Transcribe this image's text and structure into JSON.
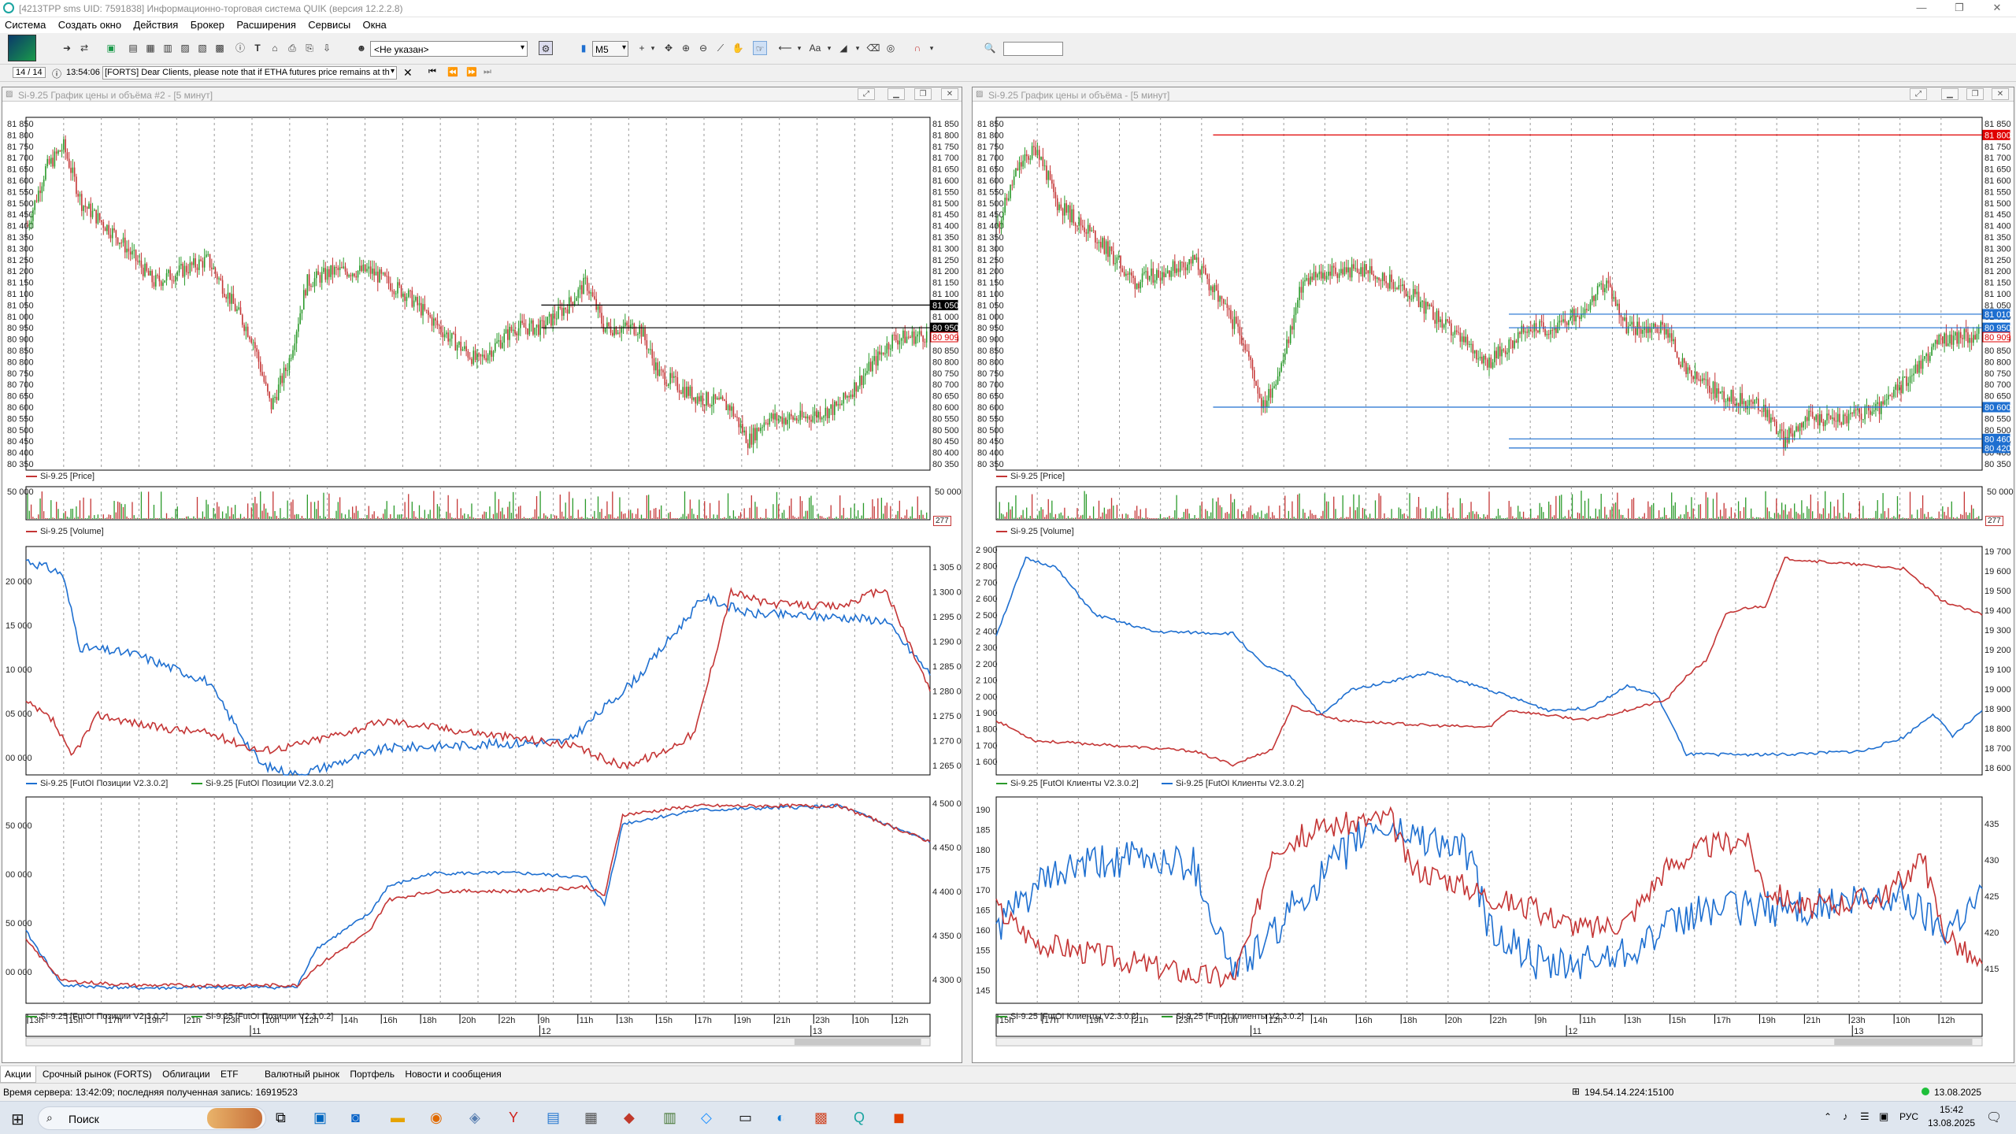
{
  "window": {
    "title": "[4213TPP sms UID: 7591838] Информационно-торговая система QUIK (версия 12.2.2.8)"
  },
  "menu": [
    "Система",
    "Создать окно",
    "Действия",
    "Брокер",
    "Расширения",
    "Сервисы",
    "Окна"
  ],
  "toolbar": {
    "account_select": "<Не указан>",
    "interval_select": "M5",
    "font_label": "Aa",
    "search_value": ""
  },
  "news": {
    "counter": "14 / 14",
    "time": "13:54:06",
    "text": "[FORTS] Dear Clients, please note that if ETHA futures price remains at th"
  },
  "left_window": {
    "title": "Si-9.25 График цены и объёма #2 - [5 минут]",
    "price_legend": "Si-9.25 [Price]",
    "volume_legend": "Si-9.25 [Volume]",
    "volume_tick_left": "50 000",
    "volume_tick_right": "50 000",
    "volume_badge": "277",
    "fut_legend_1": "Si-9.25 [FutOI Позиции V2.3.0.2]",
    "fut_legend_2": "Si-9.25 [FutOI Позиции V2.3.0.2]",
    "fut2_legend_1": "Si-9.25 [FutOI Позиции V2.3.0.2]",
    "fut2_legend_2": "Si-9.25 [FutOI Позиции V2.3.0.2]",
    "price_ticks": [
      "81 850",
      "81 800",
      "81 750",
      "81 700",
      "81 650",
      "81 600",
      "81 550",
      "81 500",
      "81 450",
      "81 400",
      "81 350",
      "81 300",
      "81 250",
      "81 200",
      "81 150",
      "81 100",
      "81 050",
      "81 000",
      "80 950",
      "80 900",
      "80 850",
      "80 800",
      "80 750",
      "80 700",
      "80 650",
      "80 600",
      "80 550",
      "80 500",
      "80 450",
      "80 400",
      "80 350"
    ],
    "price_badges": [
      {
        "text": "81 050",
        "price": 81050,
        "bg": "#000000",
        "fg": "#ffffff"
      },
      {
        "text": "80 950",
        "price": 80950,
        "bg": "#000000",
        "fg": "#ffffff"
      },
      {
        "text": "80 909",
        "price": 80909,
        "bg": "#ffffff",
        "fg": "#e00000"
      }
    ],
    "fut_left_ticks": [
      "20 000",
      "15 000",
      "10 000",
      "05 000",
      "00 000"
    ],
    "fut_right_ticks": [
      "1 305 0",
      "1 300 0",
      "1 295 0",
      "1 290 0",
      "1 285 0",
      "1 280 0",
      "1 275 0",
      "1 270 0",
      "1 265 0"
    ],
    "fut2_left_ticks": [
      "50 000",
      "00 000",
      "50 000",
      "00 000"
    ],
    "fut2_right_ticks": [
      "4 500 0",
      "4 450 0",
      "4 400 0",
      "4 350 0",
      "4 300 0"
    ],
    "time_labels": [
      "13h",
      "15h",
      "17h",
      "19h",
      "21h",
      "23h",
      "10h",
      "12h",
      "14h",
      "16h",
      "18h",
      "20h",
      "22h",
      "9h",
      "11h",
      "13h",
      "15h",
      "17h",
      "19h",
      "21h",
      "23h",
      "10h",
      "12h"
    ],
    "date_labels": [
      "11",
      "12",
      "13"
    ]
  },
  "right_window": {
    "title": "Si-9.25 График цены и объёма - [5 минут]",
    "price_legend": "Si-9.25 [Price]",
    "volume_legend": "Si-9.25 [Volume]",
    "volume_tick_right": "50 000",
    "volume_badge": "277",
    "fut_legend_1": "Si-9.25 [FutOI Клиенты V2.3.0.2]",
    "fut_legend_2": "Si-9.25 [FutOI Клиенты V2.3.0.2]",
    "fut2_legend_1": "Si-9.25 [FutOI Клиенты V2.3.0.2]",
    "fut2_legend_2": "Si-9.25 [FutOI Клиенты V2.3.0.2]",
    "price_badges": [
      {
        "text": "81 800",
        "price": 81800,
        "bg": "#e00000",
        "fg": "#ffffff"
      },
      {
        "text": "81 010",
        "price": 81010,
        "bg": "#1e6fd0",
        "fg": "#ffffff"
      },
      {
        "text": "80 950",
        "price": 80950,
        "bg": "#1e6fd0",
        "fg": "#ffffff"
      },
      {
        "text": "80 909",
        "price": 80909,
        "bg": "#ffffff",
        "fg": "#e00000"
      },
      {
        "text": "80 600",
        "price": 80600,
        "bg": "#1e6fd0",
        "fg": "#ffffff"
      },
      {
        "text": "80 460",
        "price": 80460,
        "bg": "#1e6fd0",
        "fg": "#ffffff"
      },
      {
        "text": "80 420",
        "price": 80420,
        "bg": "#1e6fd0",
        "fg": "#ffffff"
      }
    ],
    "fut_left_ticks": [
      "2 900",
      "2 800",
      "2 700",
      "2 600",
      "2 500",
      "2 400",
      "2 300",
      "2 200",
      "2 100",
      "2 000",
      "1 900",
      "1 800",
      "1 700",
      "1 600"
    ],
    "fut_right_ticks": [
      "19 700",
      "19 600",
      "19 500",
      "19 400",
      "19 300",
      "19 200",
      "19 100",
      "19 000",
      "18 900",
      "18 800",
      "18 700",
      "18 600"
    ],
    "fut2_left_ticks": [
      "190",
      "185",
      "180",
      "175",
      "170",
      "165",
      "160",
      "155",
      "150",
      "145"
    ],
    "fut2_right_ticks": [
      "435",
      "430",
      "425",
      "420",
      "415"
    ],
    "time_labels": [
      "15h",
      "17h",
      "19h",
      "21h",
      "23h",
      "10h",
      "12h",
      "14h",
      "16h",
      "18h",
      "20h",
      "22h",
      "9h",
      "11h",
      "13h",
      "15h",
      "17h",
      "19h",
      "21h",
      "23h",
      "10h",
      "12h"
    ],
    "date_labels": [
      "11",
      "12",
      "13"
    ]
  },
  "tabs": [
    "Акции",
    "Срочный рынок (FORTS)",
    "Облигации",
    "ETF",
    "Валютный рынок",
    "Портфель",
    "Новости и сообщения"
  ],
  "status": {
    "server_time": "Время сервера: 13:42:09; последняя полученная запись: 16919523",
    "connection": "194.54.14.224:15100",
    "date": "13.08.2025"
  },
  "taskbar": {
    "search_label": "Поиск",
    "lang": "РУС",
    "clock_time": "15:42",
    "clock_date": "13.08.2025"
  },
  "colors": {
    "price_up": "#2b9a2b",
    "price_down": "#c43535",
    "series_blue": "#1e6fd0",
    "series_red": "#c43535",
    "accent_red": "#e00000"
  }
}
